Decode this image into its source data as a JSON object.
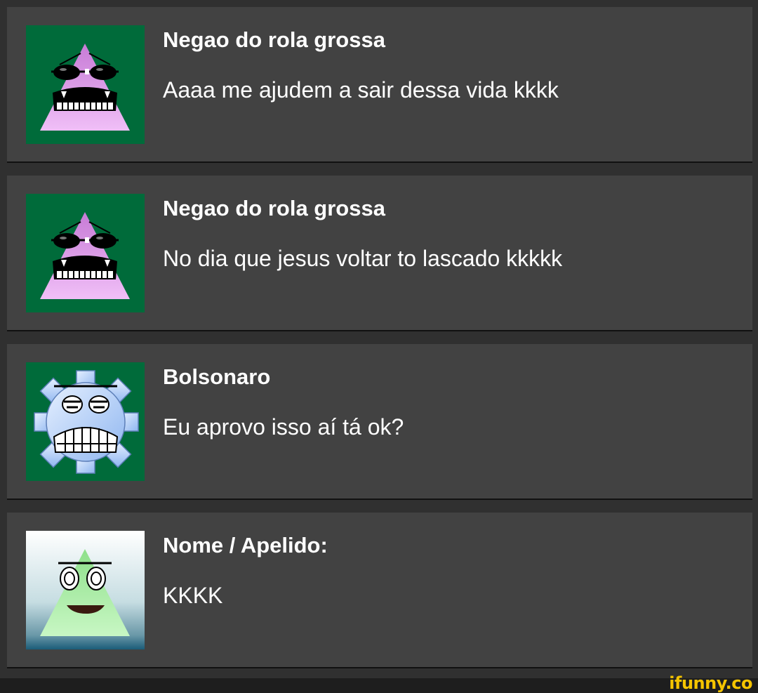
{
  "comments": [
    {
      "name": "Negao do rola grossa",
      "text": "Aaaa me ajudem a sair dessa vida kkkk",
      "avatar_icon": "triangle-sunglasses-face-icon"
    },
    {
      "name": "Negao do rola grossa",
      "text": "No dia que jesus voltar to lascado kkkkk",
      "avatar_icon": "triangle-sunglasses-face-icon"
    },
    {
      "name": "Bolsonaro",
      "text": "Eu aprovo isso aí tá ok?",
      "avatar_icon": "gear-grimace-face-icon"
    },
    {
      "name": "Nome / Apelido:",
      "text": "KKKK",
      "avatar_icon": "triangle-smile-face-icon"
    }
  ],
  "watermark": "ifunny.co",
  "colors": {
    "background": "#303030",
    "card": "#424242",
    "avatar_green": "#006b3a",
    "watermark": "#f5c400"
  }
}
